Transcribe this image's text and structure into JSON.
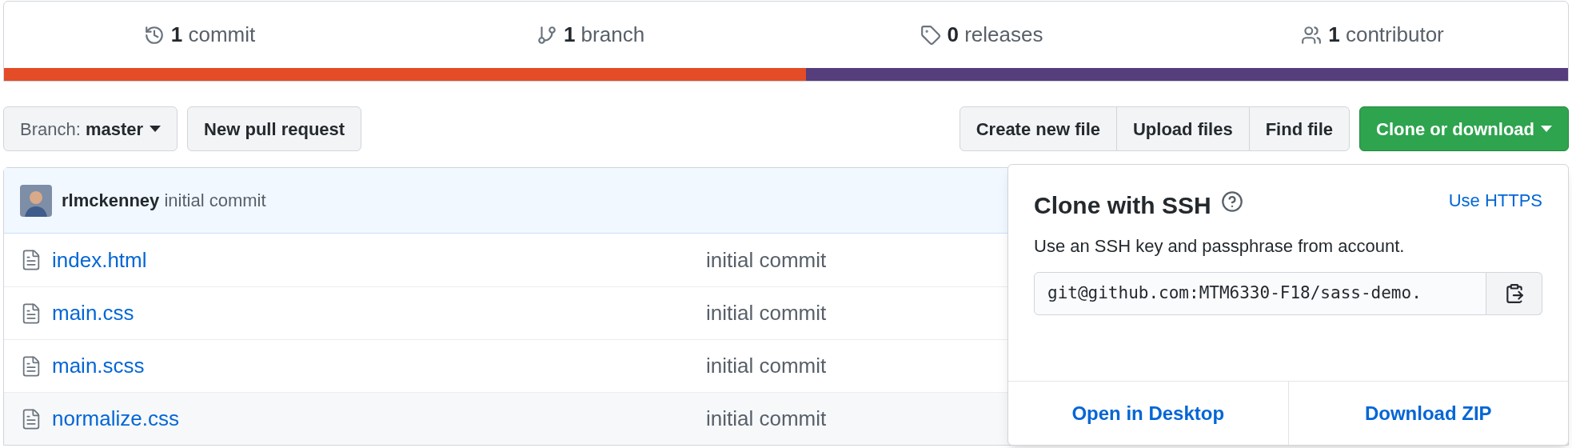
{
  "stats": [
    {
      "kind": "commits",
      "count": "1",
      "label": "commit"
    },
    {
      "kind": "branches",
      "count": "1",
      "label": "branch"
    },
    {
      "kind": "releases",
      "count": "0",
      "label": "releases"
    },
    {
      "kind": "contributors",
      "count": "1",
      "label": "contributor"
    }
  ],
  "language_bar": [
    {
      "color": "#e34c26",
      "level": 0.513
    },
    {
      "color": "#563d7c",
      "level": 0.487
    }
  ],
  "branch_select": {
    "label": "Branch:",
    "value": "master"
  },
  "new_pull_request": "New pull request",
  "file_buttons": [
    "Create new file",
    "Upload files",
    "Find file"
  ],
  "clone_button": "Clone or download",
  "commit": {
    "author": "rlmckenney",
    "message": "initial commit"
  },
  "files": [
    {
      "name": "index.html",
      "message": "initial commit"
    },
    {
      "name": "main.css",
      "message": "initial commit"
    },
    {
      "name": "main.scss",
      "message": "initial commit"
    },
    {
      "name": "normalize.css",
      "message": "initial commit"
    }
  ],
  "clone_popup": {
    "title": "Clone with SSH",
    "switch_link": "Use HTTPS",
    "description": "Use an SSH key and passphrase from account.",
    "url": "git@github.com:MTM6330-F18/sass-demo.",
    "actions": [
      "Open in Desktop",
      "Download ZIP"
    ]
  }
}
